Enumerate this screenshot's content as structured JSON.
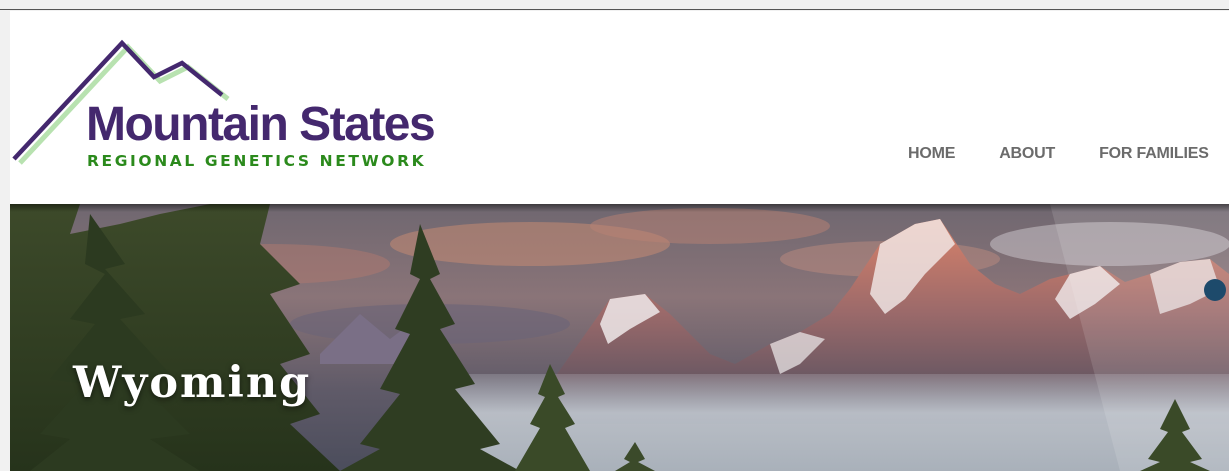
{
  "logo": {
    "title": "Mountain States",
    "subtitle": "REGIONAL GENETICS NETWORK",
    "colors": {
      "primary": "#44286e",
      "secondary": "#2b8a1c",
      "accent_light": "#b8e2b0"
    }
  },
  "nav": {
    "items": [
      {
        "label": "HOME"
      },
      {
        "label": "ABOUT"
      },
      {
        "label": "FOR FAMILIES"
      }
    ]
  },
  "hero": {
    "title": "Wyoming",
    "slider_dot_color": "#1d4a6b"
  }
}
